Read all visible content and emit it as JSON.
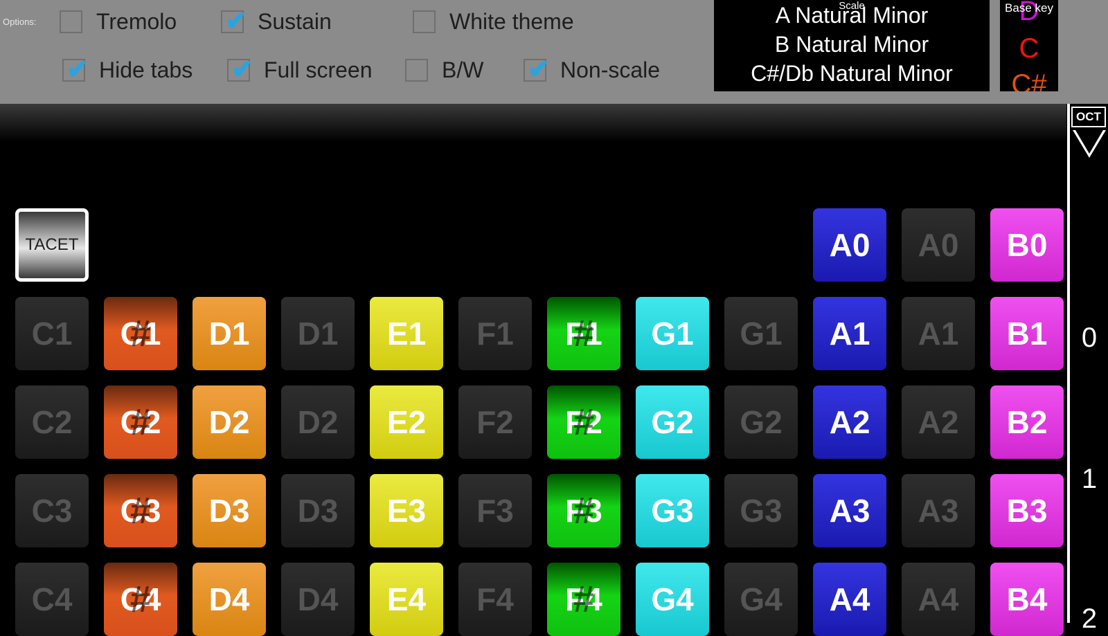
{
  "options": {
    "label": "Options:",
    "items": [
      {
        "label": "Tremolo",
        "checked": false
      },
      {
        "label": "Sustain",
        "checked": true
      },
      {
        "label": "White theme",
        "checked": false
      },
      {
        "label": "Hide tabs",
        "checked": true
      },
      {
        "label": "Full screen",
        "checked": true
      },
      {
        "label": "B/W",
        "checked": false
      },
      {
        "label": "Non-scale",
        "checked": true
      }
    ]
  },
  "scale": {
    "title": "Scale",
    "items": [
      "A Natural Minor",
      "B Natural Minor",
      "C#/Db Natural Minor"
    ]
  },
  "base_key": {
    "title": "Base key",
    "items": [
      "D",
      "C",
      "C#"
    ],
    "color": "#ff1010"
  },
  "octave": {
    "label": "OCT",
    "numbers": [
      "0",
      "1",
      "2"
    ]
  },
  "tacet_label": "TACET",
  "check_glyph": "✔",
  "sharp_glyph": "#",
  "keyboard": {
    "row0": [
      "A0",
      "A0",
      "B0"
    ],
    "rows": [
      [
        "C1",
        "C1",
        "D1",
        "D1",
        "E1",
        "F1",
        "F1",
        "G1",
        "G1",
        "A1",
        "A1",
        "B1"
      ],
      [
        "C2",
        "C2",
        "D2",
        "D2",
        "E2",
        "F2",
        "F2",
        "G2",
        "G2",
        "A2",
        "A2",
        "B2"
      ],
      [
        "C3",
        "C3",
        "D3",
        "D3",
        "E3",
        "F3",
        "F3",
        "G3",
        "G3",
        "A3",
        "A3",
        "B3"
      ],
      [
        "C4",
        "C4",
        "D4",
        "D4",
        "E4",
        "F4",
        "F4",
        "G4",
        "G4",
        "A4",
        "A4",
        "B4"
      ]
    ]
  },
  "colors": {
    "c_sharp": "#e05a20",
    "d": "#e89020",
    "e": "#dede20",
    "f_sharp": "#14d414",
    "g": "#28d8e0",
    "a": "#2828c8",
    "b": "#e040e0",
    "check": "#2aa3e0"
  }
}
